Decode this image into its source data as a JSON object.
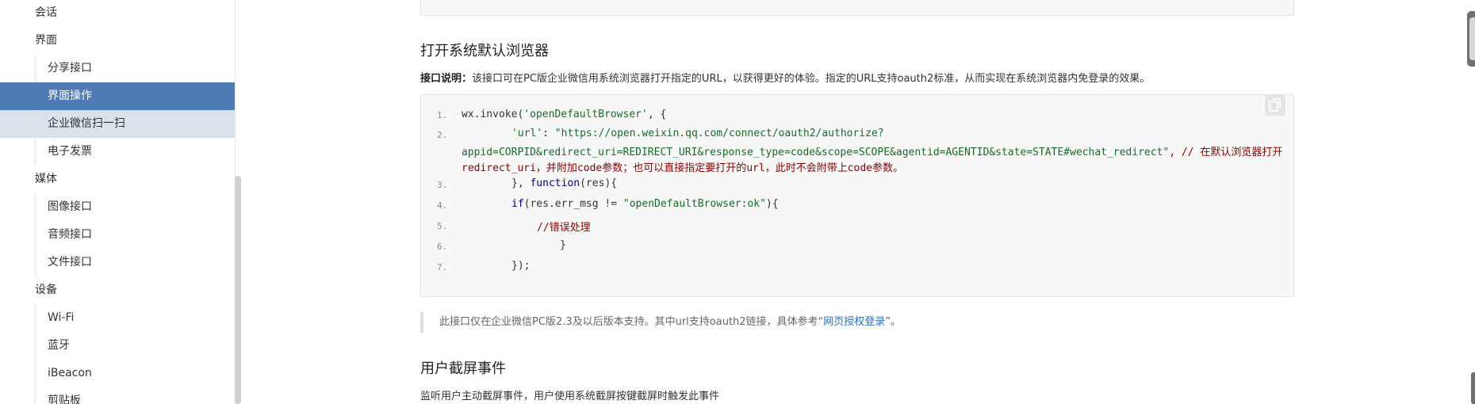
{
  "sidebar": {
    "group_session": "会话",
    "group_ui": "界面",
    "group_media": "媒体",
    "group_device": "设备",
    "items": [
      {
        "label": "分享接口"
      },
      {
        "label": "界面操作"
      },
      {
        "label": "企业微信扫一扫"
      },
      {
        "label": "电子发票"
      },
      {
        "label": "图像接口"
      },
      {
        "label": "音频接口"
      },
      {
        "label": "文件接口"
      },
      {
        "label": "Wi-Fi"
      },
      {
        "label": "蓝牙"
      },
      {
        "label": "iBeacon"
      },
      {
        "label": "剪贴板"
      }
    ]
  },
  "section1": {
    "title": "打开系统默认浏览器",
    "desc_label": "接口说明：",
    "desc_text": "该接口可在PC版企业微信用系统浏览器打开指定的URL，以获得更好的体验。指定的URL支持oauth2标准，从而实现在系统浏览器内免登录的效果。"
  },
  "code": {
    "l1_a": "wx.invoke(",
    "l1_s": "'openDefaultBrowser'",
    "l1_b": ", {",
    "l2_key": "'url'",
    "l2_colon": ": ",
    "l2_s1": "\"https://open.weixin.qq.com/connect/oauth2/authorize?",
    "l2_s2": "appid=CORPID&redirect_uri=REDIRECT_URI&response_type=code&scope=SCOPE&agentid=AGENTID&state=STATE#wechat_redirect\"",
    "l2_c1": ", // 在默认浏览器打开",
    "l2_c2": "redirect_uri，并附加code参数；也可以直接指定要打开的url，此时不会附带上code参数。",
    "l3_a": "}, ",
    "l3_kw": "function",
    "l3_b": "(res){",
    "l4_kw": "if",
    "l4_a": "(res.err_msg != ",
    "l4_s": "\"openDefaultBrowser:ok\"",
    "l4_b": "){",
    "l5_c": "//错误处理",
    "l6": "}",
    "l7": "});",
    "line_numbers": [
      "1.",
      "2.",
      "3.",
      "4.",
      "5.",
      "6.",
      "7."
    ]
  },
  "note": {
    "text_before": "此接口仅在企业微信PC版2.3及以后版本支持。其中url支持oauth2链接，具体参考“",
    "link": "网页授权登录",
    "text_after": "”。"
  },
  "section2": {
    "title": "用户截屏事件",
    "desc": "监听用户主动截屏事件，用户使用系统截屏按键截屏时触发此事件"
  },
  "icons": {
    "copy": "copy-icon"
  },
  "colors": {
    "active_bg": "#4f7bb5",
    "hover_bg": "#dae2ec",
    "link": "#2a6fc4",
    "code_string": "#166b2a",
    "code_comment": "#8b0000"
  }
}
